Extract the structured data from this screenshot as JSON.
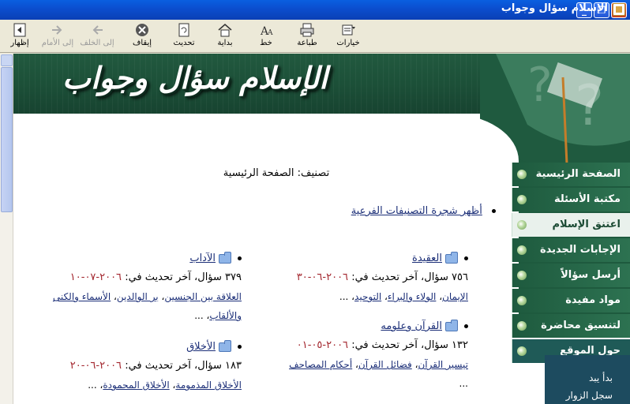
{
  "window": {
    "title": "الإسلام سؤال وجواب"
  },
  "toolbar": {
    "show": "إظهار",
    "forward": "إلى الأمام",
    "back": "إلى الخلف",
    "stop": "إيقاف",
    "refresh": "تحديث",
    "home": "بداية",
    "font": "خط",
    "print": "طباعة",
    "options": "خيارات"
  },
  "banner": {
    "title": "الإسلام سؤال وجواب"
  },
  "breadcrumb": "تصنيف: الصفحة الرئيسية",
  "tree_link": "أظهر شجرة التصنيفات الفرعية",
  "categories": [
    {
      "name": "العقيدة",
      "stats": "٧٥٦ سؤال، آخر تحديث في:",
      "date": "٢٠٠٦-٠٦-٣٠",
      "subs": [
        "الإيمان",
        "الولاء والبراء",
        "التوحيد"
      ],
      "more": "..."
    },
    {
      "name": "القرآن وعلومه",
      "stats": "١٣٢ سؤال، آخر تحديث في:",
      "date": "٢٠٠٦-٠٥-٠١",
      "subs": [
        "تيسير القرآن",
        "فضائل القرآن",
        "أحكام المصاحف"
      ],
      "more": "..."
    },
    {
      "name": "الآداب",
      "stats": "٣٧٩ سؤال، آخر تحديث في:",
      "date": "٢٠٠٦-٠٧-١٠",
      "subs": [
        "العلاقة بين الجنسين",
        "بر الوالدين",
        "الأسماء والكنى والألقاب"
      ],
      "more": "..."
    },
    {
      "name": "الأخلاق",
      "stats": "١٨٣ سؤال، آخر تحديث في:",
      "date": "٢٠٠٦-٠٦-٢٠",
      "subs": [
        "الأخلاق المذمومة",
        "الأخلاق المحمودة"
      ],
      "more": "..."
    }
  ],
  "nav": [
    "الصفحة الرئيسية",
    "مكتبة الأسئلة",
    "اعتنق الإسلام",
    "الإجابات الجديدة",
    "أرسل سؤالاً",
    "مواد مفيدة",
    "لتنسيق محاضرة",
    "حول الموقع"
  ],
  "nav_footer": [
    "بدأ يبد",
    "سجل الزوار"
  ],
  "colors": {
    "accent": "#1e5a3e",
    "link": "#1c2f78",
    "date": "#a3262e"
  }
}
